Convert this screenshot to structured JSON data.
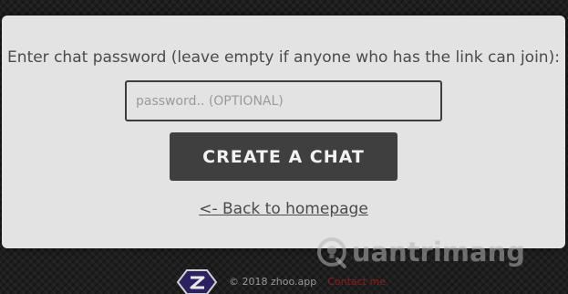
{
  "dialog": {
    "prompt": "Enter chat password (leave empty if anyone who has the link can join):",
    "password_placeholder": "password.. (OPTIONAL)",
    "password_value": "",
    "create_button_label": "CREATE A CHAT",
    "back_link_label": "<- Back to homepage"
  },
  "footer": {
    "copyright": "© 2018 zhoo.app",
    "contact_label": "Contact me"
  },
  "watermark": {
    "text": "uantrimang",
    "icon": "lightbulb-q-icon"
  },
  "colors": {
    "page_bg": "#1e1e1e",
    "card_bg": "#e3e3e3",
    "button_bg": "#3f3f3f",
    "button_text": "#f2f2f2",
    "text": "#4a4a4a",
    "logo_purple": "#3a2a7a",
    "contact_red": "#8a1f1f"
  }
}
